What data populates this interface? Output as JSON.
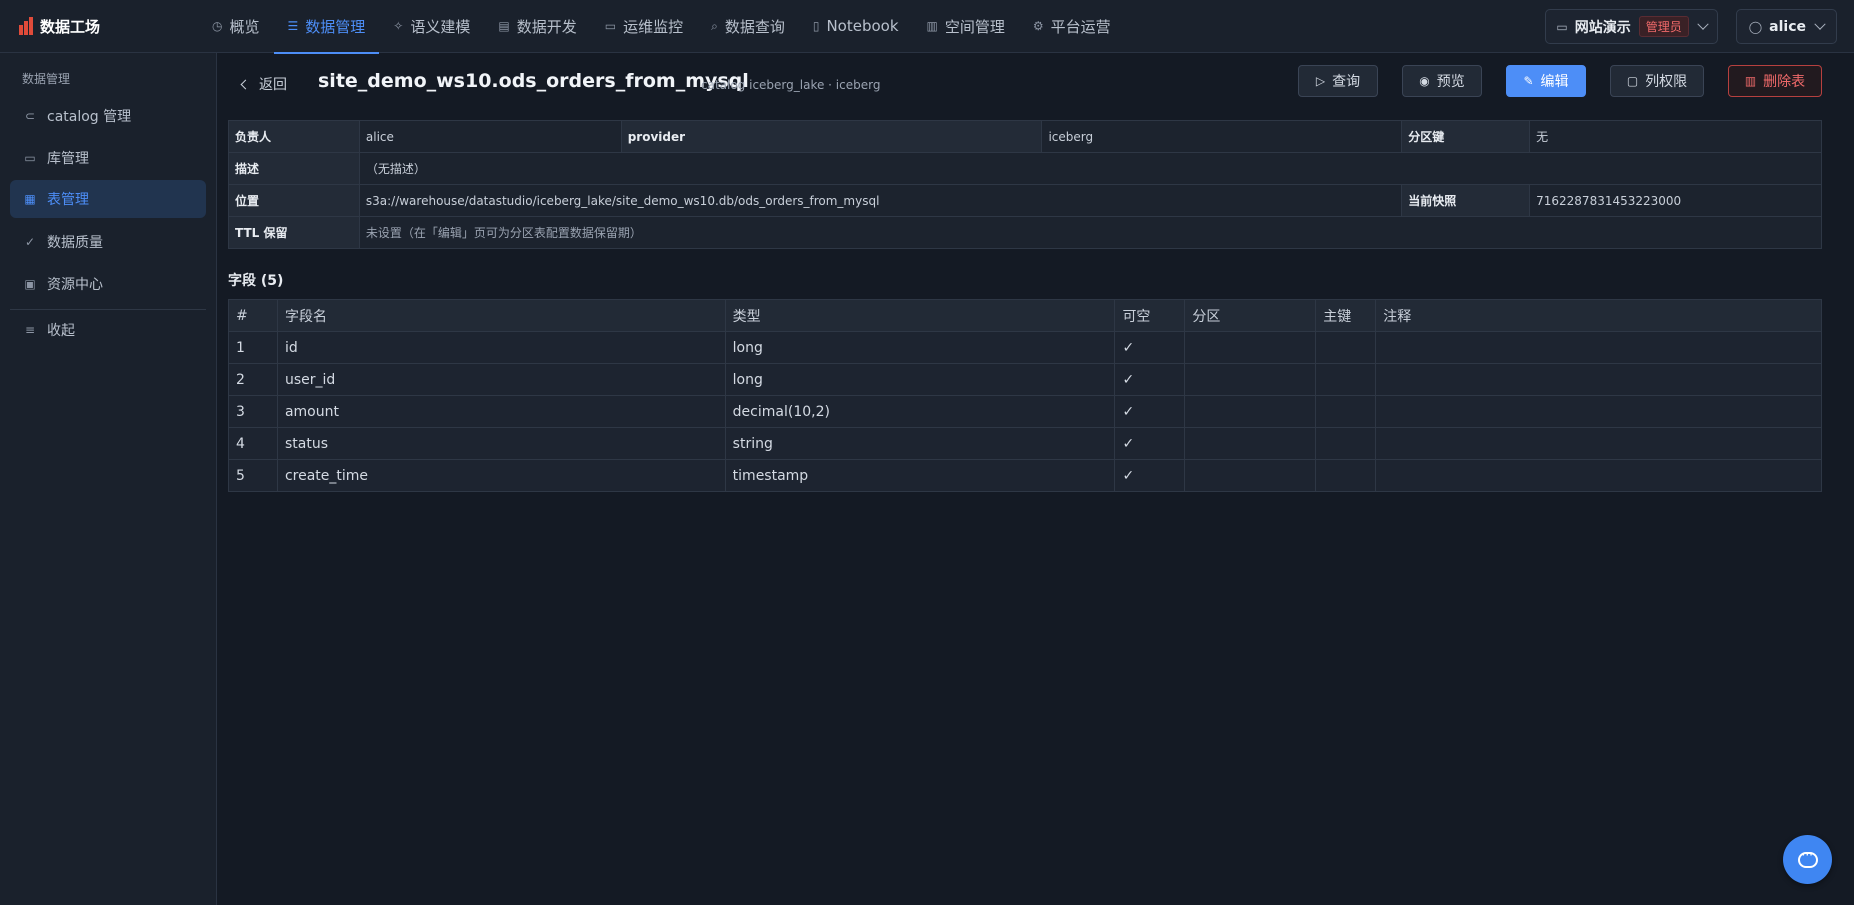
{
  "app": {
    "brand": "数据工场"
  },
  "nav": [
    {
      "label": "概览",
      "icon": "gauge-icon"
    },
    {
      "label": "数据管理",
      "icon": "database-icon",
      "active": true
    },
    {
      "label": "语义建模",
      "icon": "sparkle-icon"
    },
    {
      "label": "数据开发",
      "icon": "code-file-icon"
    },
    {
      "label": "运维监控",
      "icon": "monitor-icon"
    },
    {
      "label": "数据查询",
      "icon": "search-icon"
    },
    {
      "label": "Notebook",
      "icon": "notebook-icon"
    },
    {
      "label": "空间管理",
      "icon": "building-icon"
    },
    {
      "label": "平台运营",
      "icon": "gear-icon"
    }
  ],
  "workspace": {
    "name": "网站演示",
    "role": "管理员"
  },
  "user": {
    "name": "alice"
  },
  "sidebar": {
    "title": "数据管理",
    "items": [
      {
        "label": "catalog 管理",
        "icon": "link-icon"
      },
      {
        "label": "库管理",
        "icon": "folder-icon"
      },
      {
        "label": "表管理",
        "icon": "grid-icon",
        "active": true
      },
      {
        "label": "数据质量",
        "icon": "check-circle-icon"
      },
      {
        "label": "资源中心",
        "icon": "briefcase-icon"
      }
    ],
    "collapse_label": "收起"
  },
  "page": {
    "back_label": "返回",
    "title": "site_demo_ws10.ods_orders_from_mysql",
    "subtitle": "catalog iceberg_lake · iceberg",
    "buttons": {
      "query": "查询",
      "preview": "预览",
      "edit": "编辑",
      "column_perm": "列权限",
      "delete": "删除表"
    }
  },
  "info": {
    "owner_label": "负责人",
    "owner": "alice",
    "provider_label": "provider",
    "provider": "iceberg",
    "partition_label": "分区键",
    "partition": "无",
    "desc_label": "描述",
    "desc": "（无描述）",
    "location_label": "位置",
    "location": "s3a://warehouse/datastudio/iceberg_lake/site_demo_ws10.db/ods_orders_from_mysql",
    "snapshot_label": "当前快照",
    "snapshot": "7162287831453223000",
    "ttl_label": "TTL 保留",
    "ttl": "未设置（在「编辑」页可为分区表配置数据保留期）"
  },
  "fields": {
    "title": "字段 (5)",
    "columns": [
      "#",
      "字段名",
      "类型",
      "可空",
      "分区",
      "主键",
      "注释"
    ],
    "rows": [
      [
        "1",
        "id",
        "long",
        "✓",
        "",
        "",
        ""
      ],
      [
        "2",
        "user_id",
        "long",
        "✓",
        "",
        "",
        ""
      ],
      [
        "3",
        "amount",
        "decimal(10,2)",
        "✓",
        "",
        "",
        ""
      ],
      [
        "4",
        "status",
        "string",
        "✓",
        "",
        "",
        ""
      ],
      [
        "5",
        "create_time",
        "timestamp",
        "✓",
        "",
        "",
        ""
      ]
    ]
  }
}
